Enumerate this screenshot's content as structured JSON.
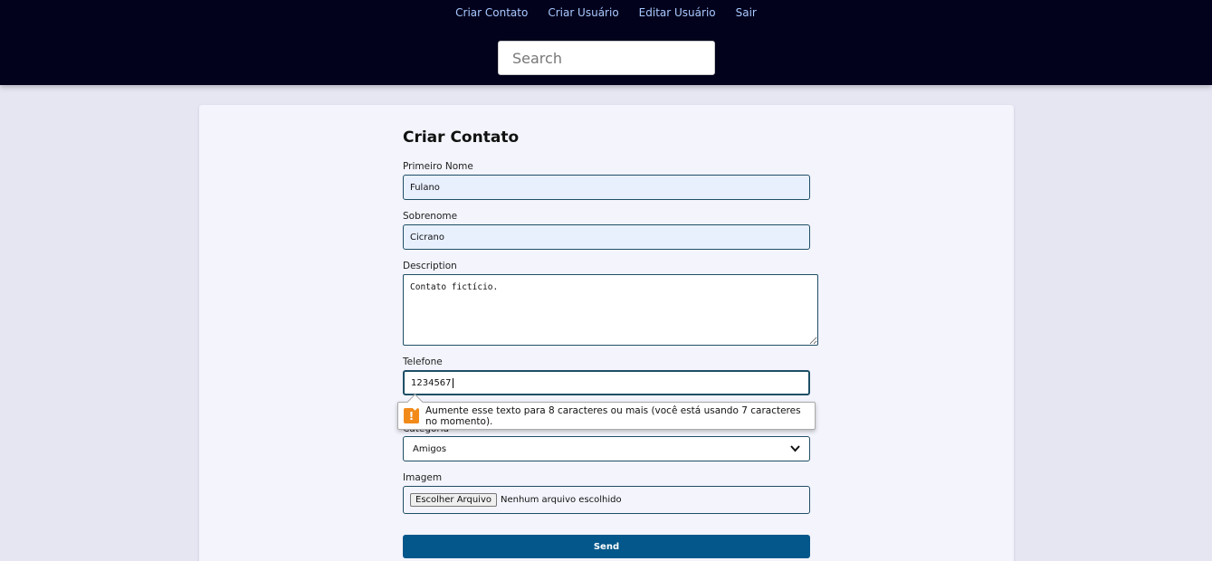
{
  "nav": {
    "items": [
      "Criar Contato",
      "Criar Usuário",
      "Editar Usuário",
      "Sair"
    ]
  },
  "search": {
    "placeholder": "Search",
    "value": ""
  },
  "form": {
    "title": "Criar Contato",
    "first_name": {
      "label": "Primeiro Nome",
      "value": "Fulano"
    },
    "last_name": {
      "label": "Sobrenome",
      "value": "Cicrano"
    },
    "description": {
      "label": "Description",
      "value": "Contato fictício."
    },
    "phone": {
      "label": "Telefone",
      "value": "1234567"
    },
    "validation_message": "Aumente esse texto para 8 caracteres ou mais (você está usando 7 caracteres no momento).",
    "category": {
      "label": "Categoria",
      "selected": "Amigos"
    },
    "image": {
      "label": "Imagem",
      "button_label": "Escolher Arquivo",
      "status": "Nenhum arquivo escolhido"
    },
    "send_label": "Send"
  },
  "colors": {
    "topbar": "#02021c",
    "nav_link": "#a9c9ff",
    "page_bg": "#e6e6f3",
    "card_bg": "#f3f4fc",
    "field_border": "#1f4f66",
    "send_button": "#04578a",
    "warning": "#f28a1a"
  }
}
